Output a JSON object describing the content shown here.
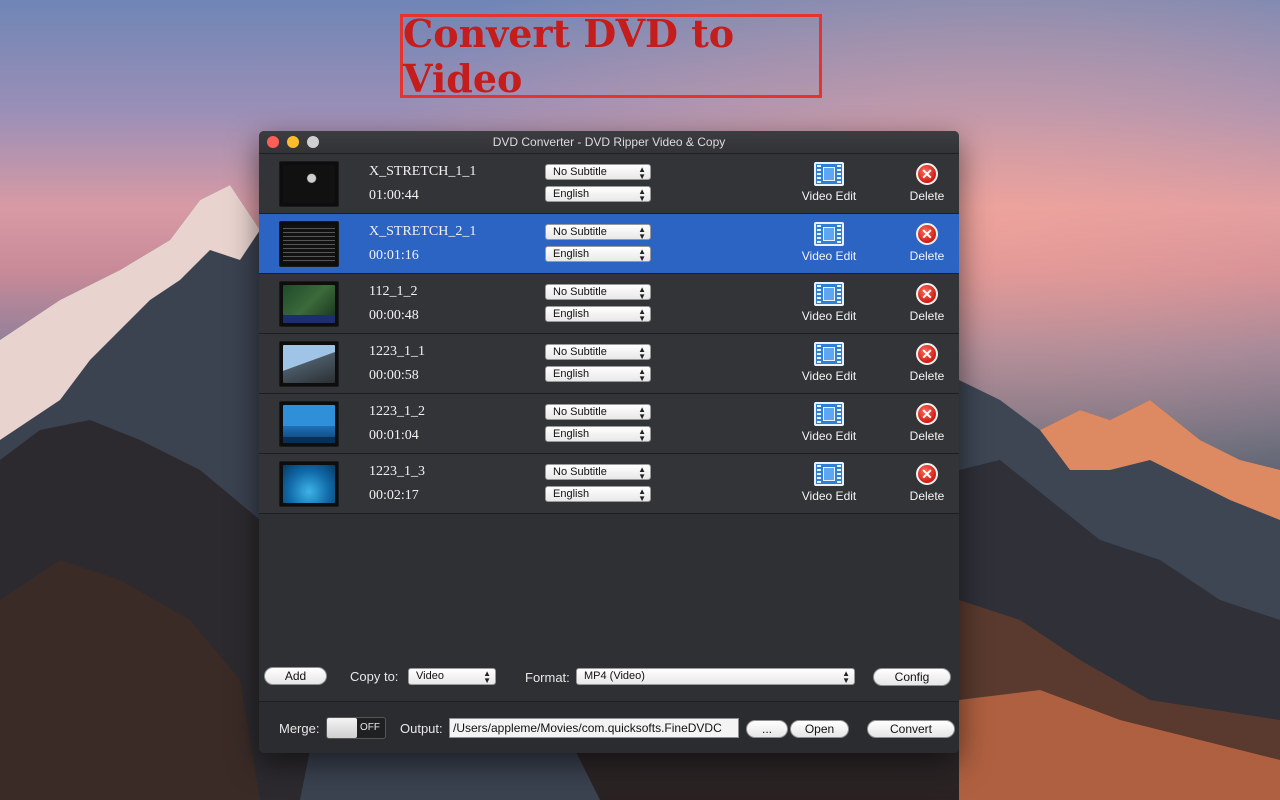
{
  "banner": {
    "text": "Convert DVD to Video"
  },
  "window": {
    "title": "DVD Converter - DVD Ripper Video & Copy"
  },
  "rows": [
    {
      "name": "X_STRETCH_1_1",
      "duration": "01:00:44",
      "subtitle": "No Subtitle",
      "audio": "English",
      "edit_label": "Video Edit",
      "delete_label": "Delete",
      "selected": false
    },
    {
      "name": "X_STRETCH_2_1",
      "duration": "00:01:16",
      "subtitle": "No Subtitle",
      "audio": "English",
      "edit_label": "Video Edit",
      "delete_label": "Delete",
      "selected": true
    },
    {
      "name": "112_1_2",
      "duration": "00:00:48",
      "subtitle": "No Subtitle",
      "audio": "English",
      "edit_label": "Video Edit",
      "delete_label": "Delete",
      "selected": false
    },
    {
      "name": "1223_1_1",
      "duration": "00:00:58",
      "subtitle": "No Subtitle",
      "audio": "English",
      "edit_label": "Video Edit",
      "delete_label": "Delete",
      "selected": false
    },
    {
      "name": "1223_1_2",
      "duration": "00:01:04",
      "subtitle": "No Subtitle",
      "audio": "English",
      "edit_label": "Video Edit",
      "delete_label": "Delete",
      "selected": false
    },
    {
      "name": "1223_1_3",
      "duration": "00:02:17",
      "subtitle": "No Subtitle",
      "audio": "English",
      "edit_label": "Video Edit",
      "delete_label": "Delete",
      "selected": false
    }
  ],
  "toolbar": {
    "add_label": "Add",
    "copy_to_label": "Copy to:",
    "copy_to_value": "Video",
    "format_label": "Format:",
    "format_value": "MP4 (Video)",
    "config_label": "Config"
  },
  "footer": {
    "merge_label": "Merge:",
    "merge_state": "OFF",
    "output_label": "Output:",
    "output_path": "/Users/appleme/Movies/com.quicksofts.FineDVDC",
    "browse_label": "...",
    "open_label": "Open",
    "convert_label": "Convert"
  },
  "colors": {
    "selection": "#2c64c4",
    "banner_red": "#c51d1b",
    "window_bg": "#2f3034"
  }
}
